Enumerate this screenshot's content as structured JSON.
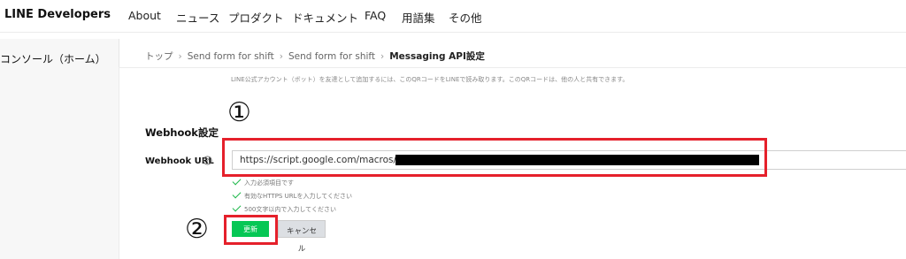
{
  "header": {
    "logo": "LINE Developers",
    "nav": [
      "About",
      "ニュース",
      "プロダクト",
      "ドキュメント",
      "FAQ",
      "用語集",
      "その他"
    ]
  },
  "sidebar": {
    "items": [
      {
        "label": "コンソール（ホーム）"
      }
    ]
  },
  "breadcrumb": [
    "トップ",
    "Send form for shift",
    "Send form for shift",
    "Messaging API設定"
  ],
  "description": "LINE公式アカウント（ボット）を友達として追加するには、このQRコードをLINEで読み取ります。このQRコードは、他の人と共有できます。",
  "annotations": {
    "step1": "①",
    "step2": "②",
    "highlight_color": "#e5202b"
  },
  "webhook": {
    "section_title": "Webhook設定",
    "field_label": "Webhook URL",
    "help_icon": "question-circle-icon",
    "url_value": "https://script.google.com/macros/s/AK",
    "validation": [
      "入力必須項目です",
      "有効なHTTPS URLを入力してください",
      "500文字以内で入力してください"
    ],
    "update_label": "更新",
    "cancel_label": "キャンセル"
  },
  "colors": {
    "accent": "#06c755",
    "check": "#1db84a"
  }
}
